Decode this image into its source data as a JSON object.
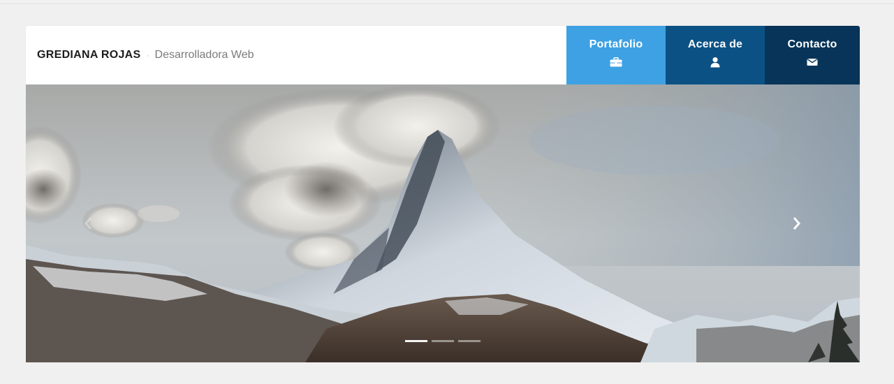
{
  "header": {
    "name": "GREDIANA ROJAS",
    "separator": "·",
    "subtitle": "Desarrolladora Web"
  },
  "nav": {
    "items": [
      {
        "label": "Portafolio",
        "icon": "briefcase-icon",
        "color": "#3ea1e3"
      },
      {
        "label": "Acerca de",
        "icon": "user-icon",
        "color": "#0c5184"
      },
      {
        "label": "Contacto",
        "icon": "envelope-icon",
        "color": "#073458"
      }
    ]
  },
  "slider": {
    "image": "mountain-landscape",
    "slide_count": 3,
    "active_slide": 1
  }
}
